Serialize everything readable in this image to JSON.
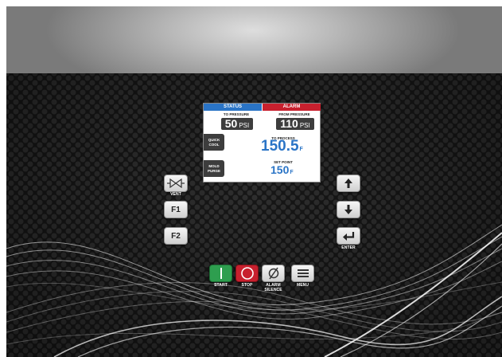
{
  "left_keys": {
    "vent_label": "VENT",
    "f1_label": "F1",
    "f2_label": "F2",
    "vent_icon": "valve-icon"
  },
  "right_keys": {
    "up_icon": "arrow-up-icon",
    "down_icon": "arrow-down-icon",
    "enter_icon": "enter-icon",
    "enter_label": "ENTER"
  },
  "screen": {
    "status_tab": "STATUS",
    "alarm_tab": "ALARM",
    "to_pressure_label": "TO PRESSURE",
    "to_pressure_value": "50",
    "to_pressure_unit": "PSI",
    "from_pressure_label": "FROM PRESSURE",
    "from_pressure_value": "110",
    "from_pressure_unit": "PSI",
    "quick_cool_line1": "QUICK",
    "quick_cool_line2": "COOL",
    "mold_purge_line1": "MOLD",
    "mold_purge_line2": "PURGE",
    "to_process_label": "TO PROCESS",
    "to_process_value": "150.5",
    "to_process_unit": "F",
    "set_point_label": "SET POINT",
    "set_point_value": "150",
    "set_point_unit": "F"
  },
  "bottom_buttons": {
    "start_label": "START",
    "stop_label": "STOP",
    "alarm_silence_line1": "ALARM",
    "alarm_silence_line2": "SILENCE",
    "menu_label": "MENU",
    "start_color": "#2e9e4f",
    "stop_color": "#c8202e"
  }
}
